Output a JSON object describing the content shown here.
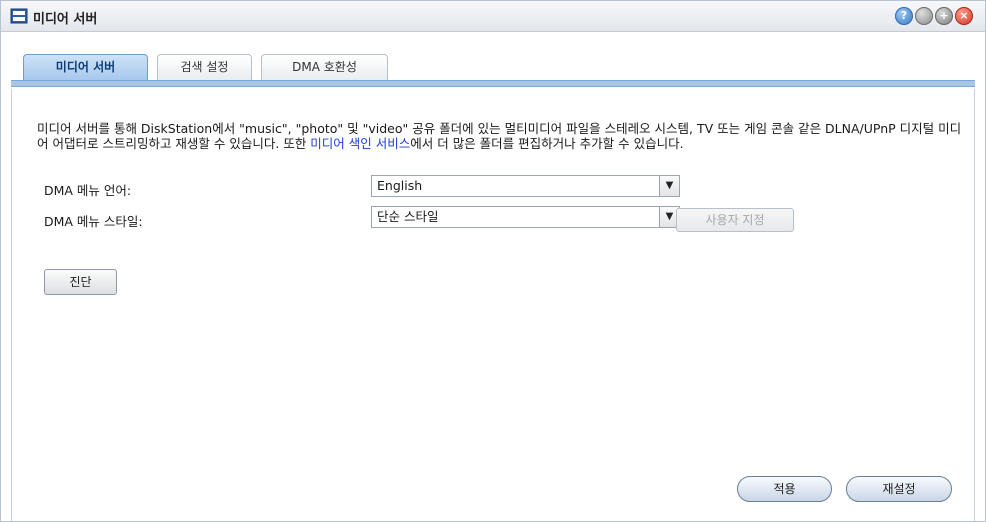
{
  "window": {
    "title": "미디어 서버"
  },
  "tabs": [
    {
      "label": "미디어 서버"
    },
    {
      "label": "검색 설정"
    },
    {
      "label": "DMA 호환성"
    }
  ],
  "description": {
    "text_before_link": "미디어 서버를 통해 DiskStation에서 \"music\", \"photo\" 및 \"video\" 공유 폴더에 있는 멀티미디어 파일을 스테레오 시스템, TV 또는 게임 콘솔 같은 DLNA/UPnP 디지털 미디어 어댑터로 스트리밍하고 재생할 수 있습니다. 또한 ",
    "link_text": "미디어 색인 서비스",
    "text_after_link": "에서 더 많은 폴더를 편집하거나 추가할 수 있습니다."
  },
  "settings": {
    "language_label": "DMA 메뉴 언어:",
    "language_value": "English",
    "style_label": "DMA 메뉴 스타일:",
    "style_value": "단순 스타일",
    "customize_label": "사용자 지정"
  },
  "buttons": {
    "diagnose": "진단",
    "apply": "적용",
    "reset": "재설정"
  },
  "icons": {
    "app": "media-server-icon",
    "help": "help-icon",
    "minimize": "minimize-icon",
    "maximize": "maximize-icon",
    "close": "close-icon",
    "dropdown": "chevron-down-icon"
  }
}
